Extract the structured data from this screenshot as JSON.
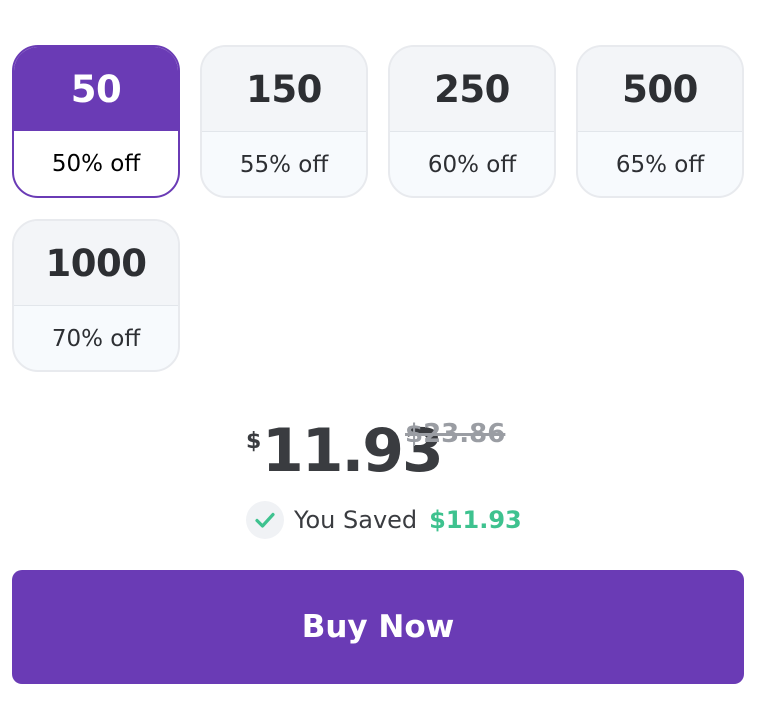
{
  "options": [
    {
      "quantity": "50",
      "discount": "50% off",
      "selected": true
    },
    {
      "quantity": "150",
      "discount": "55% off",
      "selected": false
    },
    {
      "quantity": "250",
      "discount": "60% off",
      "selected": false
    },
    {
      "quantity": "500",
      "discount": "65% off",
      "selected": false
    },
    {
      "quantity": "1000",
      "discount": "70% off",
      "selected": false
    }
  ],
  "pricing": {
    "currency_symbol": "$",
    "price": "11.93",
    "original_price": "$23.86"
  },
  "savings": {
    "label": "You Saved",
    "amount": "$11.93",
    "icon": "check-icon"
  },
  "buy_button": {
    "label": "Buy Now"
  },
  "colors": {
    "accent": "#6a3bb5",
    "success": "#3ec28f",
    "text": "#2d2f33",
    "muted": "#9a9da3"
  }
}
